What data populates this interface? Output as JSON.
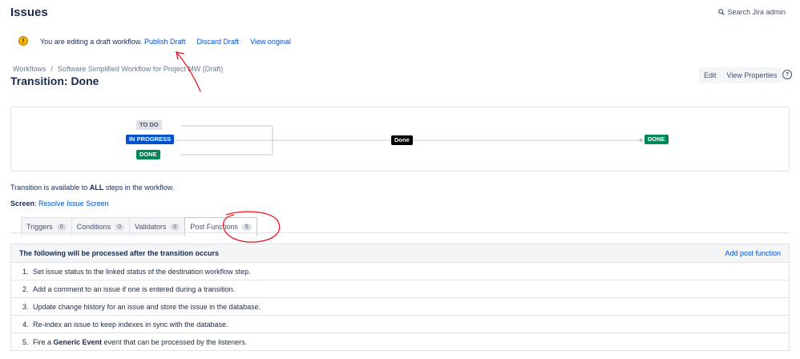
{
  "header": {
    "title": "Issues",
    "search_label": "Search Jira admin"
  },
  "draft_banner": {
    "text": "You are editing a draft workflow.",
    "publish_label": "Publish Draft",
    "discard_label": "Discard Draft",
    "view_original_label": "View original"
  },
  "breadcrumb": {
    "root": "Workflows",
    "separator": "/",
    "workflow": "Software Simplified Workflow for Project MW (Draft)"
  },
  "transition_title": "Transition: Done",
  "buttons": {
    "edit": "Edit",
    "view_properties": "View Properties"
  },
  "diagram": {
    "source_statuses": [
      "TO DO",
      "IN PROGRESS",
      "DONE"
    ],
    "transition": "Done",
    "target_status": "DONE"
  },
  "availability": {
    "prefix": "Transition is available to ",
    "emphasis": "ALL",
    "suffix": " steps in the workflow."
  },
  "screen": {
    "label": "Screen",
    "value": "Resolve Issue Screen"
  },
  "tabs": [
    {
      "label": "Triggers",
      "count": "0"
    },
    {
      "label": "Conditions",
      "count": "0"
    },
    {
      "label": "Validators",
      "count": "0"
    },
    {
      "label": "Post Functions",
      "count": "5"
    }
  ],
  "post_functions": {
    "header": "The following will be processed after the transition occurs",
    "add_label": "Add post function",
    "items": [
      {
        "num": "1.",
        "pre": "Set issue status to the linked status of the destination workflow step.",
        "bold": "",
        "post": ""
      },
      {
        "num": "2.",
        "pre": "Add a comment to an issue if one is entered during a transition.",
        "bold": "",
        "post": ""
      },
      {
        "num": "3.",
        "pre": "Update change history for an issue and store the issue in the database.",
        "bold": "",
        "post": ""
      },
      {
        "num": "4.",
        "pre": "Re-index an issue to keep indexes in sync with the database.",
        "bold": "",
        "post": ""
      },
      {
        "num": "5.",
        "pre": "Fire a ",
        "bold": "Generic Event",
        "post": " event that can be processed by the listeners."
      }
    ]
  },
  "colors": {
    "link": "#0052cc",
    "annotation": "#e8141e",
    "status_done": "#00875a",
    "status_in_progress": "#0052cc"
  }
}
